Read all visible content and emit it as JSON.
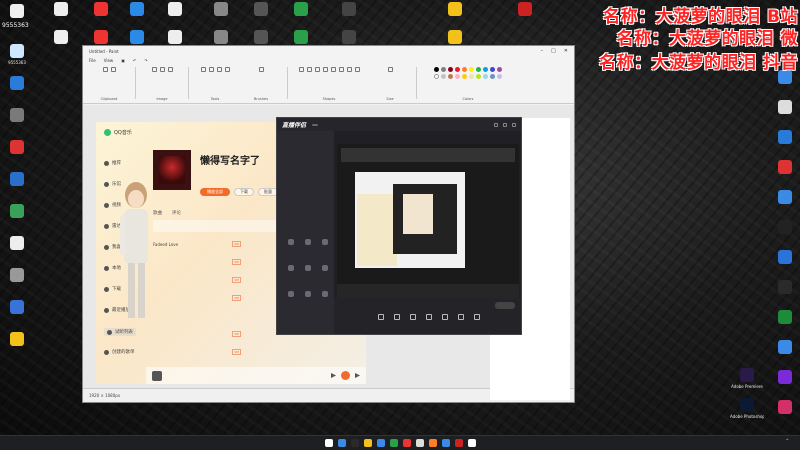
{
  "desktop": {
    "user_label": "9555363",
    "left_icons": [
      {
        "label": "",
        "color": "#f0f0f0"
      },
      {
        "label": "9555363",
        "color": "#cfe6ff"
      },
      {
        "label": "",
        "color": "#2b7bd8"
      },
      {
        "label": "",
        "color": "#7a7a7a"
      },
      {
        "label": "",
        "color": "#d33"
      },
      {
        "label": "",
        "color": "#2a6fc9"
      },
      {
        "label": "",
        "color": "#3aa15a"
      },
      {
        "label": "",
        "color": "#eee"
      },
      {
        "label": "",
        "color": "#999"
      },
      {
        "label": "",
        "color": "#3a73d8"
      },
      {
        "label": "",
        "color": "#f3c21a"
      }
    ],
    "top_icons": [
      {
        "label": "",
        "color": "#eee"
      },
      {
        "label": "",
        "color": "#e33"
      },
      {
        "label": "",
        "color": "#2a8ae6"
      },
      {
        "label": "",
        "color": "#eee"
      },
      {
        "label": "",
        "color": "#888"
      },
      {
        "label": "",
        "color": "#555"
      },
      {
        "label": "",
        "color": "#2aa04a"
      },
      {
        "label": "",
        "color": "#444"
      },
      {
        "label": "",
        "color": "#f3c21a"
      },
      {
        "label": "",
        "color": "#c22"
      }
    ],
    "right_icons": [
      {
        "label": "",
        "color": "#3a8ae6"
      },
      {
        "label": "",
        "color": "#ddd"
      },
      {
        "label": "",
        "color": "#2a7bd8"
      },
      {
        "label": "",
        "color": "#d33"
      },
      {
        "label": "",
        "color": "#3a8ae6"
      },
      {
        "label": "",
        "color": "#222"
      },
      {
        "label": "",
        "color": "#2a73d8"
      },
      {
        "label": "",
        "color": "#2a2a2a"
      },
      {
        "label": "",
        "color": "#1d8b3a"
      },
      {
        "label": "",
        "color": "#3a8ae6"
      },
      {
        "label": "",
        "color": "#7b2ad8"
      },
      {
        "label": "",
        "color": "#d3306a"
      },
      {
        "label": "Adobe Premiere",
        "color": "#2a1a4a"
      },
      {
        "label": "Adobe Photoshop",
        "color": "#0b1a33"
      }
    ]
  },
  "overlay": {
    "lines": [
      "名称：大菠萝的眼泪  B站",
      "名称：大菠萝的眼泪  微",
      "名称：大菠萝的眼泪  抖音"
    ],
    "color": "#ff2222"
  },
  "chat": {
    "lines": [
      {
        "text": "",
        "red": false
      },
      {
        "text": "",
        "red": false
      },
      {
        "text": "",
        "red": false
      },
      {
        "text": "",
        "red": false
      },
      {
        "text": "",
        "red": false
      },
      {
        "text": "",
        "red": true
      },
      {
        "text": "",
        "red": false
      }
    ],
    "lines2": [
      {
        "text": ""
      },
      {
        "text": ""
      },
      {
        "text": ""
      }
    ]
  },
  "paint": {
    "title": "Untitled - Paint",
    "menu": [
      "File",
      "View"
    ],
    "groups": [
      "Clipboard",
      "Image",
      "Tools",
      "Brushes",
      "Shapes",
      "Size",
      "Colors"
    ],
    "status": {
      "size": "1920 × 1080px",
      "zoom": "100%"
    },
    "colors": [
      "#000000",
      "#7f7f7f",
      "#880015",
      "#ed1c24",
      "#ff7f27",
      "#fff200",
      "#22b14c",
      "#00a2e8",
      "#3f48cc",
      "#a349a4",
      "#ffffff",
      "#c3c3c3",
      "#b97a57",
      "#ffaec9",
      "#ffc90e",
      "#efe4b0",
      "#b5e61d",
      "#99d9ea",
      "#7092be",
      "#c8bfe7"
    ]
  },
  "music": {
    "app_name": "QQ音乐",
    "album_title": "懒得写名字了",
    "album_meta": "",
    "play_all": "播放全部",
    "actions": [
      "下载",
      "批量"
    ],
    "tabs": [
      "歌曲",
      "评论"
    ],
    "sidebar": [
      "推荐",
      "乐馆",
      "视频",
      "雷达",
      "我喜欢",
      "本地",
      "下载",
      "最近播放",
      "试听列表",
      "创建的歌单"
    ],
    "songs": [
      {
        "name": "",
        "tag": "",
        "artist": "",
        "album": ""
      },
      {
        "name": "Fadeed Love",
        "tag": "VIP",
        "artist": "",
        "album": ""
      },
      {
        "name": "",
        "tag": "VIP",
        "artist": "",
        "album": ""
      },
      {
        "name": "",
        "tag": "VIP",
        "artist": "",
        "album": ""
      },
      {
        "name": "",
        "tag": "VIP",
        "artist": "",
        "album": ""
      },
      {
        "name": "",
        "tag": "",
        "artist": "",
        "album": ""
      },
      {
        "name": "",
        "tag": "VIP",
        "artist": "",
        "album": ""
      },
      {
        "name": "",
        "tag": "VIP",
        "artist": "",
        "album": ""
      }
    ],
    "player": {
      "track": ""
    }
  },
  "stream": {
    "logo": "直播伴侣",
    "badge": "",
    "tabs": [
      "",
      ""
    ],
    "scene_labels": [
      "",
      "",
      "",
      "",
      "",
      "",
      "",
      "",
      ""
    ],
    "bottom_buttons": [
      "",
      "",
      "",
      "",
      "",
      "",
      ""
    ],
    "live_button": ""
  },
  "taskbar": {
    "icons": [
      "#ffffff",
      "#3a8ae6",
      "#2a2a2a",
      "#f3c21a",
      "#3a8ae6",
      "#2aa04a",
      "#e33",
      "#ddd",
      "#ff7f27",
      "#3a8ae6",
      "#c22",
      "#ffffff"
    ],
    "time": ""
  }
}
